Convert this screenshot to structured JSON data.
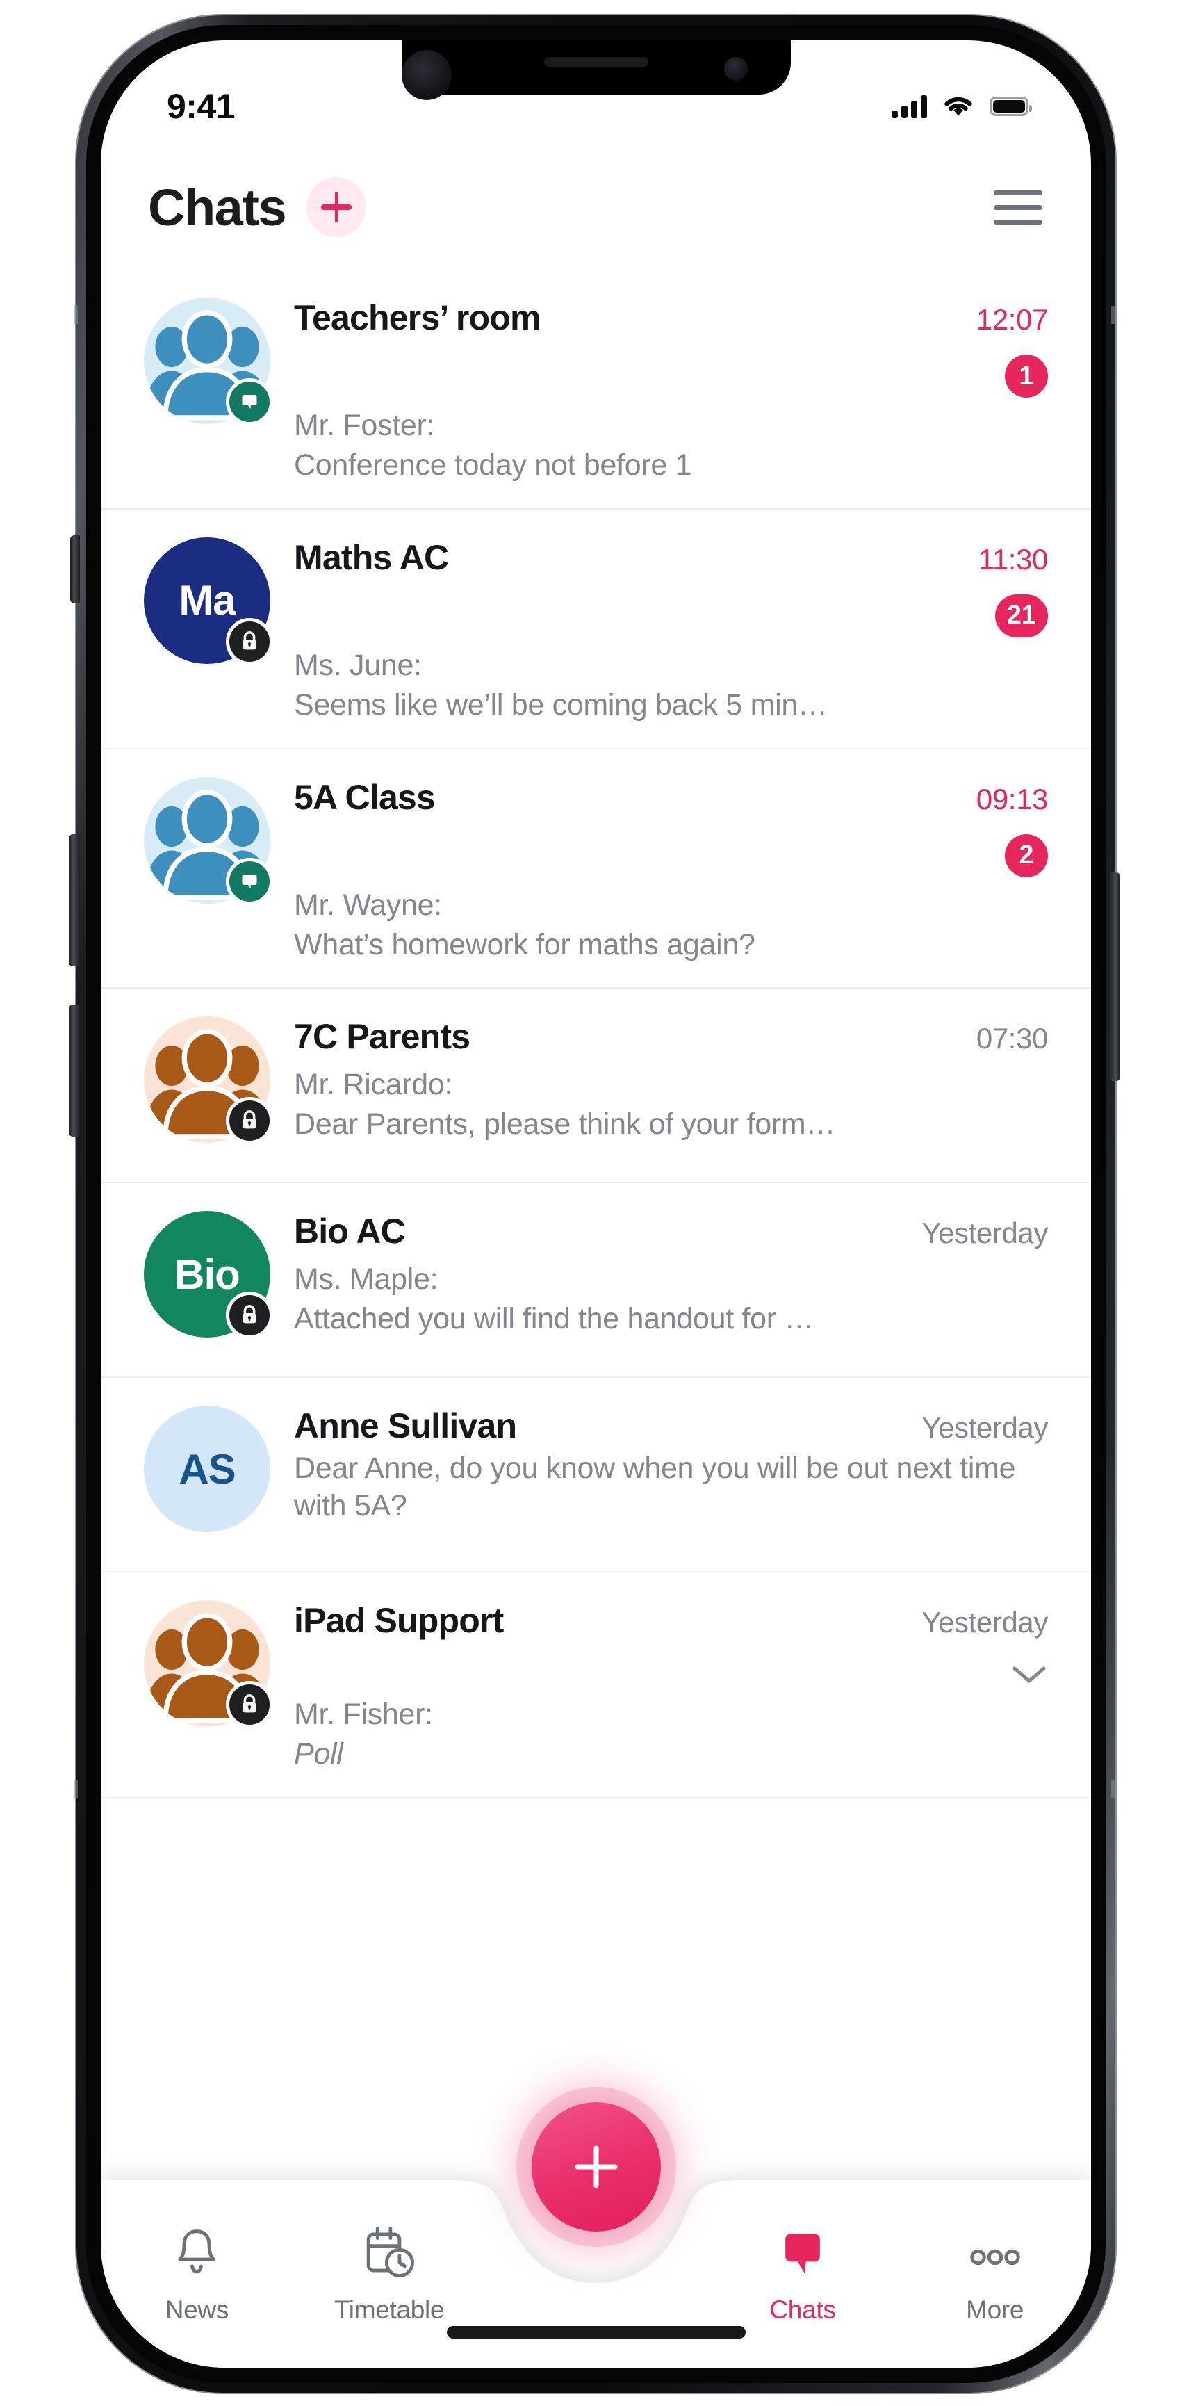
{
  "status_bar": {
    "time": "9:41",
    "cellular_icon": "cellular-signal-icon",
    "wifi_icon": "wifi-icon",
    "battery_icon": "battery-icon"
  },
  "header": {
    "title": "Chats",
    "add_icon": "plus-icon",
    "menu_icon": "hamburger-menu-icon"
  },
  "chats": [
    {
      "name": "Teachers’ room",
      "sender": "Mr. Foster:",
      "preview": "Conference today not before 1",
      "time": "12:07",
      "unread": "1",
      "has_unread": true,
      "avatar_type": "group",
      "avatar_bg": "#d7ecf7",
      "avatar_fg": "#3d8fbe",
      "badge": "message",
      "badge_color": "#127a63"
    },
    {
      "name": "Maths AC",
      "sender": "Ms. June:",
      "preview": "Seems like we’ll be coming back 5 min…",
      "time": "11:30",
      "unread": "21",
      "has_unread": true,
      "avatar_type": "initials",
      "initials": "Ma",
      "avatar_bg": "#1b2d82",
      "avatar_fg": "#ffffff",
      "badge": "lock",
      "badge_color": "#1f2024"
    },
    {
      "name": "5A Class",
      "sender": "Mr. Wayne:",
      "preview": "What’s homework for maths again?",
      "time": "09:13",
      "unread": "2",
      "has_unread": true,
      "avatar_type": "group",
      "avatar_bg": "#d7ecf7",
      "avatar_fg": "#3d8fbe",
      "badge": "message",
      "badge_color": "#127a63"
    },
    {
      "name": "7C Parents",
      "sender": "Mr. Ricardo:",
      "preview": "Dear Parents, please think of your form…",
      "time": "07:30",
      "unread": "",
      "has_unread": false,
      "avatar_type": "group",
      "avatar_bg": "#fbe3d5",
      "avatar_fg": "#a85916",
      "badge": "lock",
      "badge_color": "#1f2024"
    },
    {
      "name": "Bio AC",
      "sender": "Ms. Maple:",
      "preview": "Attached you will find the handout for …",
      "time": "Yesterday",
      "unread": "",
      "has_unread": false,
      "avatar_type": "initials",
      "initials": "Bio",
      "avatar_bg": "#12865f",
      "avatar_fg": "#ffffff",
      "badge": "lock",
      "badge_color": "#1f2024"
    },
    {
      "name": "Anne Sullivan",
      "sender": "",
      "preview": "Dear Anne, do you know when you will be out next time with 5A?",
      "time": "Yesterday",
      "unread": "",
      "has_unread": false,
      "avatar_type": "initials",
      "initials": "AS",
      "avatar_bg": "#d3e7f8",
      "avatar_fg": "#17558f",
      "badge": "none",
      "badge_color": ""
    },
    {
      "name": "iPad Support",
      "sender": "Mr. Fisher:",
      "preview": "Poll",
      "preview_italic": true,
      "time": "Yesterday",
      "unread": "",
      "has_unread": false,
      "has_chevron": true,
      "chevron_icon": "chevron-down-icon",
      "avatar_type": "group",
      "avatar_bg": "#fbe3d5",
      "avatar_fg": "#a85916",
      "badge": "lock",
      "badge_color": "#1f2024"
    }
  ],
  "tabbar": {
    "items": [
      {
        "label": "News",
        "icon": "bell-icon",
        "active": false
      },
      {
        "label": "Timetable",
        "icon": "calendar-clock-icon",
        "active": false
      },
      {
        "label": "Chats",
        "icon": "speech-bubble-icon",
        "active": true
      },
      {
        "label": "More",
        "icon": "three-dots-icon",
        "active": false
      }
    ],
    "fab_icon": "plus-icon"
  },
  "colors": {
    "accent": "#e7265e",
    "accent_soft": "#fde9ef",
    "muted_text": "#83878d",
    "title_text": "#16171a"
  }
}
